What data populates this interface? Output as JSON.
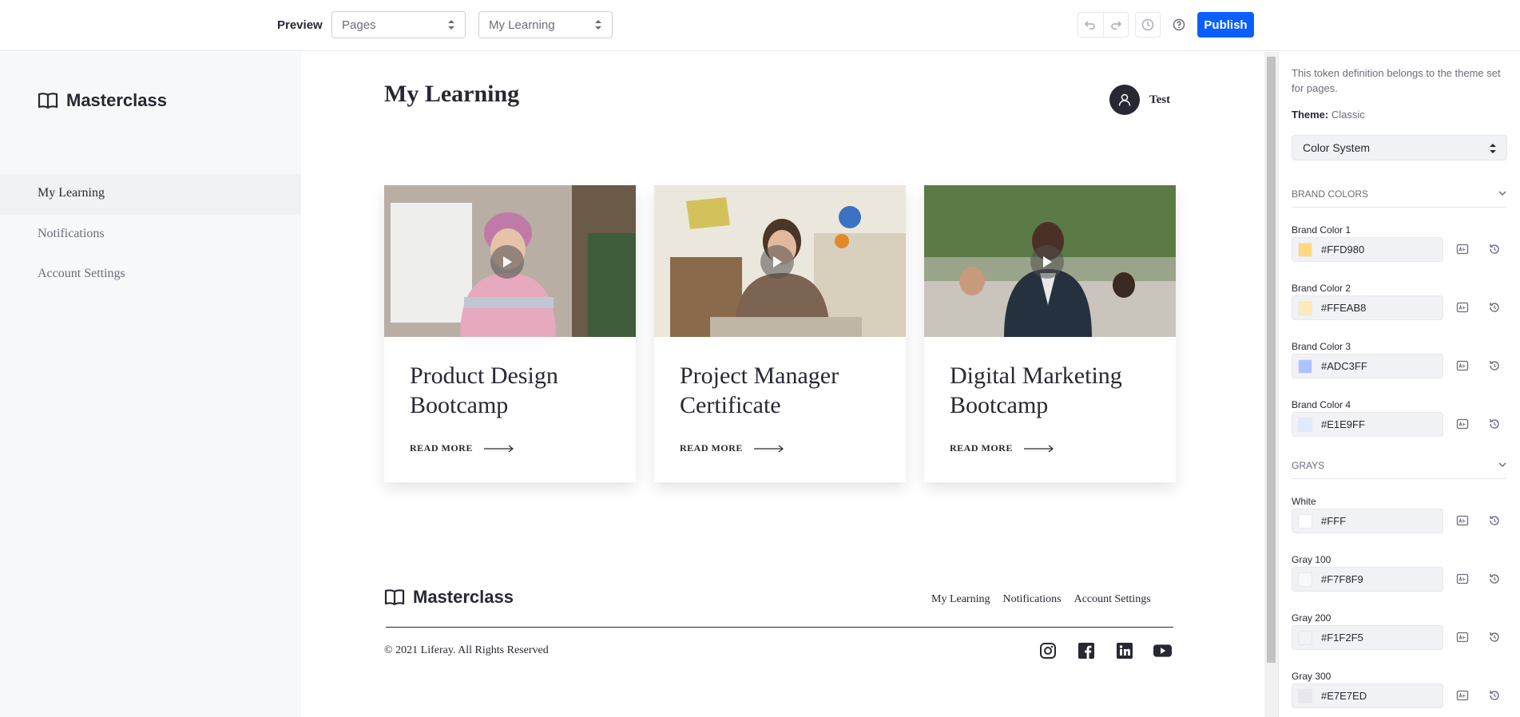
{
  "toolbar": {
    "preview_label": "Preview",
    "select_pages": "Pages",
    "select_page": "My Learning",
    "publish_label": "Publish"
  },
  "sidebar": {
    "brand": "Masterclass",
    "items": [
      {
        "label": "My Learning"
      },
      {
        "label": "Notifications"
      },
      {
        "label": "Account Settings"
      }
    ]
  },
  "main": {
    "title": "My Learning",
    "user_name": "Test",
    "cards": [
      {
        "title": "Product Design Bootcamp",
        "cta": "READ MORE"
      },
      {
        "title": "Project Manager Certificate",
        "cta": "READ MORE"
      },
      {
        "title": "Digital Marketing Bootcamp",
        "cta": "READ MORE"
      }
    ],
    "footer": {
      "brand": "Masterclass",
      "links": [
        "My Learning",
        "Notifications",
        "Account Settings"
      ],
      "copyright": "© 2021 Liferay. All Rights Reserved"
    }
  },
  "panel": {
    "note": "This token definition belongs to the theme set for pages.",
    "theme_label": "Theme:",
    "theme_value": "Classic",
    "select_value": "Color System",
    "sections": {
      "brand": "BRAND COLORS",
      "grays": "GRAYS"
    },
    "tokens": [
      {
        "label": "Brand Color 1",
        "value": "#FFD980",
        "color": "#FFD980"
      },
      {
        "label": "Brand Color 2",
        "value": "#FFEAB8",
        "color": "#FFEAB8"
      },
      {
        "label": "Brand Color 3",
        "value": "#ADC3FF",
        "color": "#ADC3FF"
      },
      {
        "label": "Brand Color 4",
        "value": "#E1E9FF",
        "color": "#E1E9FF"
      },
      {
        "label": "White",
        "value": "#FFF",
        "color": "#FFFFFF"
      },
      {
        "label": "Gray 100",
        "value": "#F7F8F9",
        "color": "#F7F8F9"
      },
      {
        "label": "Gray 200",
        "value": "#F1F2F5",
        "color": "#F1F2F5"
      },
      {
        "label": "Gray 300",
        "value": "#E7E7ED",
        "color": "#E7E7ED"
      }
    ]
  }
}
